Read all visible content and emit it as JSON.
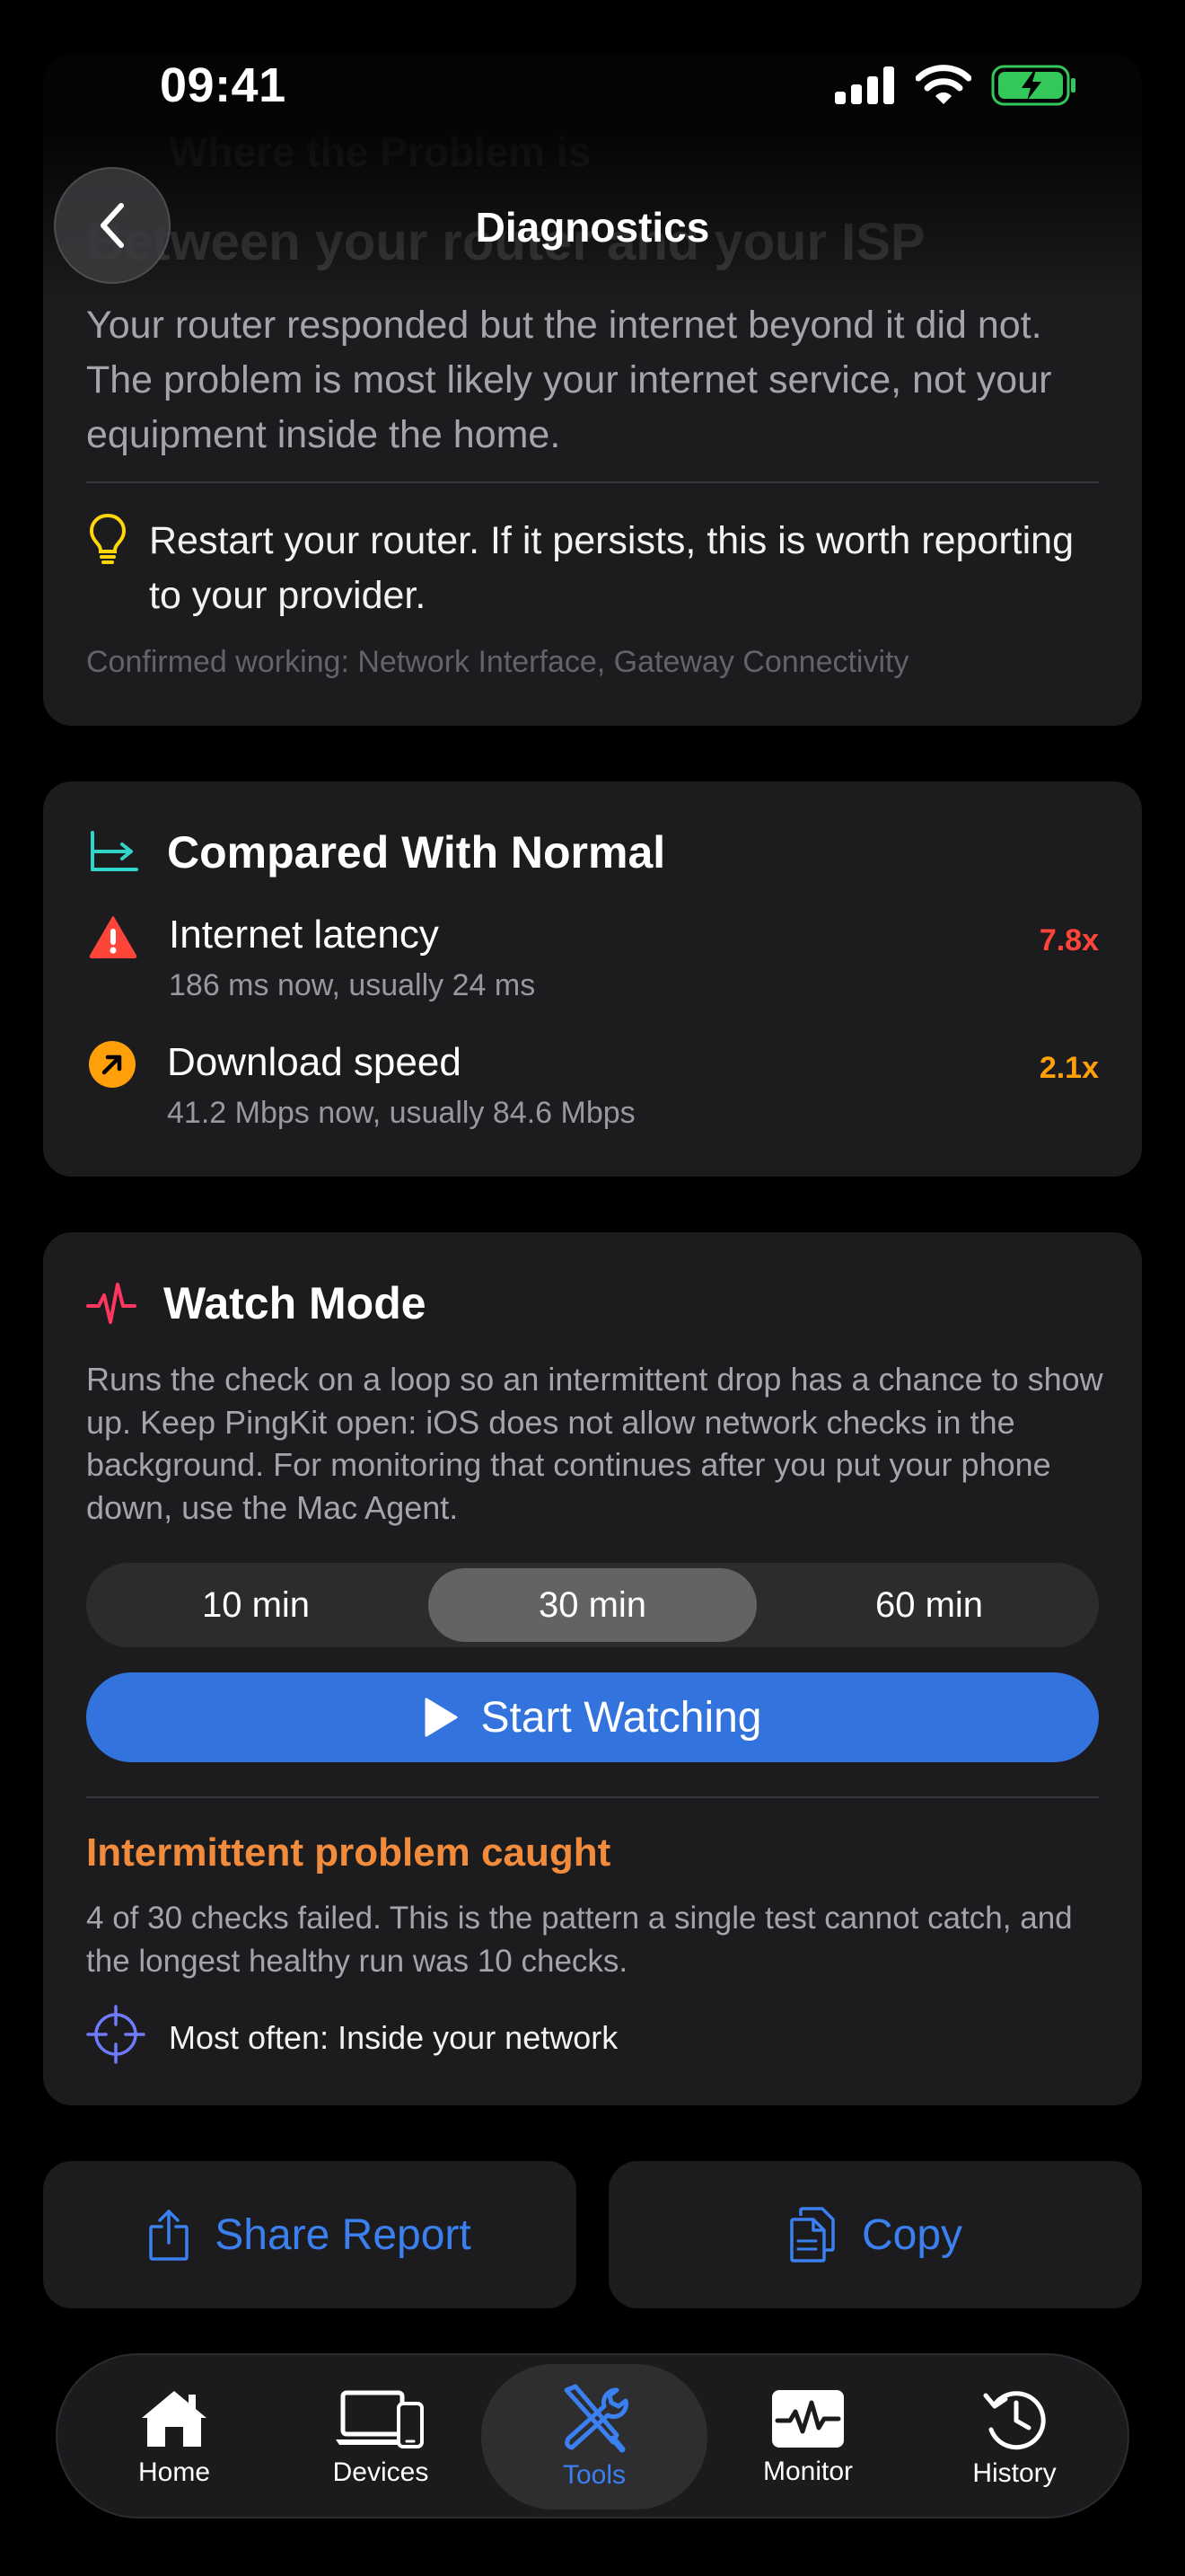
{
  "status_bar": {
    "time": "09:41"
  },
  "nav": {
    "title": "Diagnostics"
  },
  "diagnosis": {
    "heading_ghost": "Where the Problem is",
    "title_ghost": "Between your router and your ISP",
    "body": "Your router responded but the internet beyond it did not. The problem is most likely your internet service, not your equipment inside the home.",
    "tip": "Restart your router. If it persists, this is worth reporting to your provider.",
    "confirmed": "Confirmed working: Network Interface, Gateway Connectivity"
  },
  "comparison": {
    "title": "Compared With Normal",
    "rows": [
      {
        "title": "Internet latency",
        "subtitle": "186 ms now, usually 24 ms",
        "value": "7.8x",
        "color": "#ff453a"
      },
      {
        "title": "Download speed",
        "subtitle": "41.2 Mbps now, usually 84.6 Mbps",
        "value": "2.1x",
        "color": "#ff9f0a"
      }
    ]
  },
  "watch": {
    "title": "Watch Mode",
    "description": "Runs the check on a loop so an intermittent drop has a chance to show up. Keep PingKit open: iOS does not allow network checks in the background. For monitoring that continues after you put your phone down, use the Mac Agent.",
    "durations": [
      "10 min",
      "30 min",
      "60 min"
    ],
    "selected_duration": "30 min",
    "start_label": "Start Watching",
    "result_title": "Intermittent problem caught",
    "result_body": "4 of 30 checks failed. This is the pattern a single test cannot catch, and the longest healthy run was 10 checks.",
    "most_often": "Most often: Inside your network"
  },
  "actions": {
    "share": "Share Report",
    "copy": "Copy"
  },
  "tabs": [
    {
      "label": "Home",
      "icon": "house-icon"
    },
    {
      "label": "Devices",
      "icon": "devices-icon"
    },
    {
      "label": "Tools",
      "icon": "tools-icon",
      "active": true
    },
    {
      "label": "Monitor",
      "icon": "waveform-icon"
    },
    {
      "label": "History",
      "icon": "clock-history-icon"
    }
  ],
  "colors": {
    "accent": "#3a80f0",
    "warning_orange": "#f28c3c",
    "error_red": "#ff453a",
    "battery_green": "#34c759"
  }
}
